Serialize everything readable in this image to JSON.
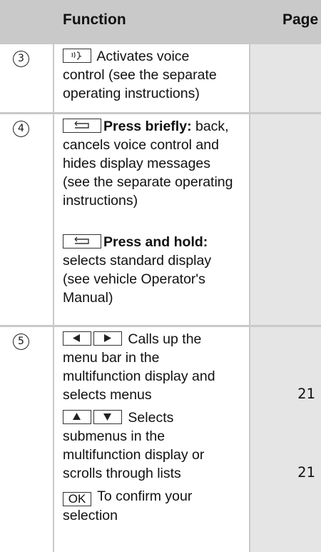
{
  "header": {
    "function_label": "Function",
    "page_label": "Page"
  },
  "rows": [
    {
      "number": "3",
      "line1": "Activates voice",
      "line2": "control (see the separate",
      "line3": "operating instructions)"
    },
    {
      "number": "4",
      "press_briefly_label": "Press briefly:",
      "press_briefly_line1": " back,",
      "press_briefly_line2": "cancels voice control and",
      "press_briefly_line3": "hides display messages",
      "press_briefly_line4": "(see the separate operating",
      "press_briefly_line5": "instructions)",
      "press_hold_label": "Press and hold:",
      "press_hold_line1": "selects standard display",
      "press_hold_line2": "(see vehicle Operator's",
      "press_hold_line3": "Manual)"
    },
    {
      "number": "5",
      "menu_line1": "Calls up the",
      "menu_line2": "menu bar in the",
      "menu_line3": "multifunction display and",
      "menu_line4": "selects menus",
      "menu_page": "21",
      "sub_line1": "Selects",
      "sub_line2": "submenus in the",
      "sub_line3": "multifunction display or",
      "sub_line4": "scrolls through lists",
      "sub_page": "21",
      "ok_key": "OK",
      "ok_line1": "To confirm your",
      "ok_line2": "selection"
    }
  ],
  "icons": {
    "voice": "voice-control-key-icon",
    "back": "back-key-icon",
    "left": "left-arrow-key-icon",
    "right": "right-arrow-key-icon",
    "up": "up-arrow-key-icon",
    "down": "down-arrow-key-icon"
  },
  "colors": {
    "header_bg": "#c9c9c9",
    "page_column_bg": "#e5e5e5",
    "cell_bg": "#ffffff"
  }
}
